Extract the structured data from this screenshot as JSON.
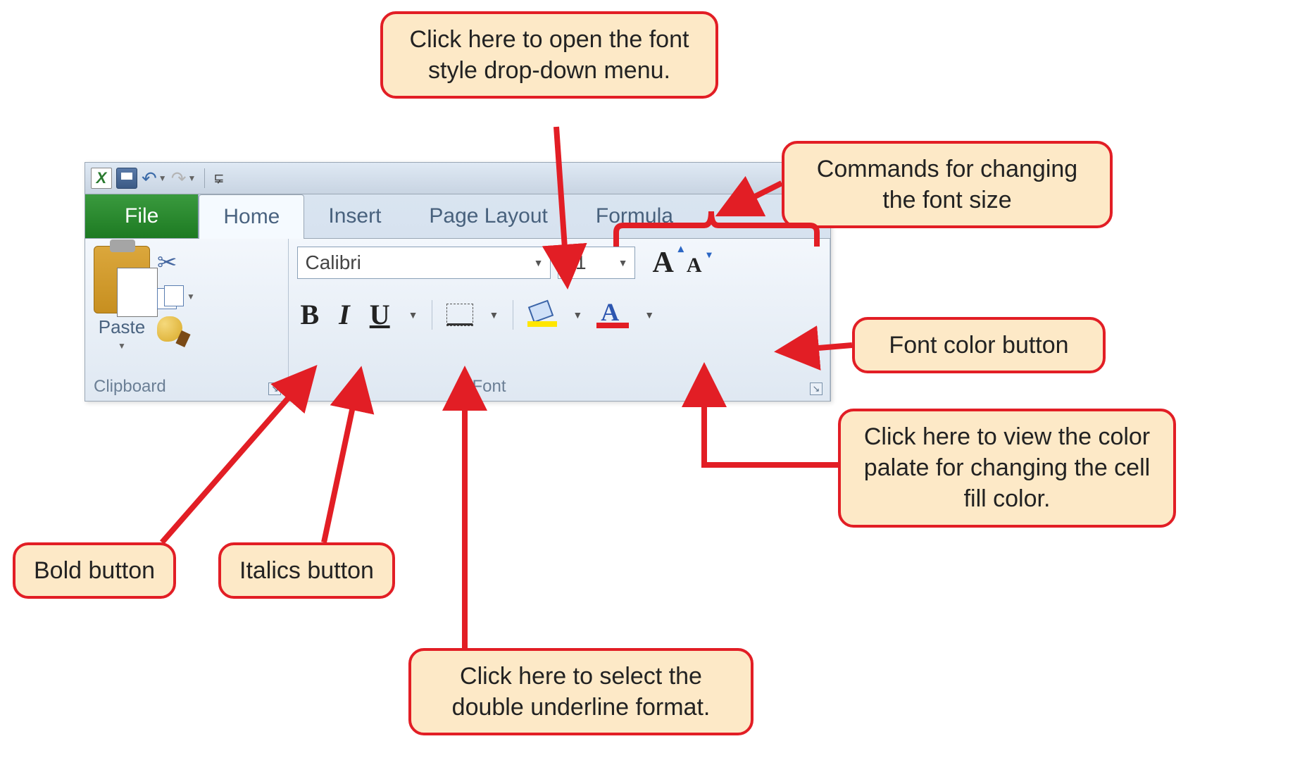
{
  "titlebar": {
    "app_letter": "X"
  },
  "tabs": {
    "file": "File",
    "home": "Home",
    "insert": "Insert",
    "page_layout": "Page Layout",
    "formulas": "Formula"
  },
  "clipboard": {
    "group_label": "Clipboard",
    "paste_label": "Paste"
  },
  "font_group": {
    "group_label": "Font",
    "font_name": "Calibri",
    "font_size": "11"
  },
  "callouts": {
    "font_dropdown": "Click here to open the font style drop-down menu.",
    "font_size_cmds": "Commands for changing the font size",
    "font_color": "Font color button",
    "fill_color": "Click here to view the color palate for changing the cell fill color.",
    "bold": "Bold button",
    "italics": "Italics button",
    "underline": "Click here to select the double underline format."
  }
}
